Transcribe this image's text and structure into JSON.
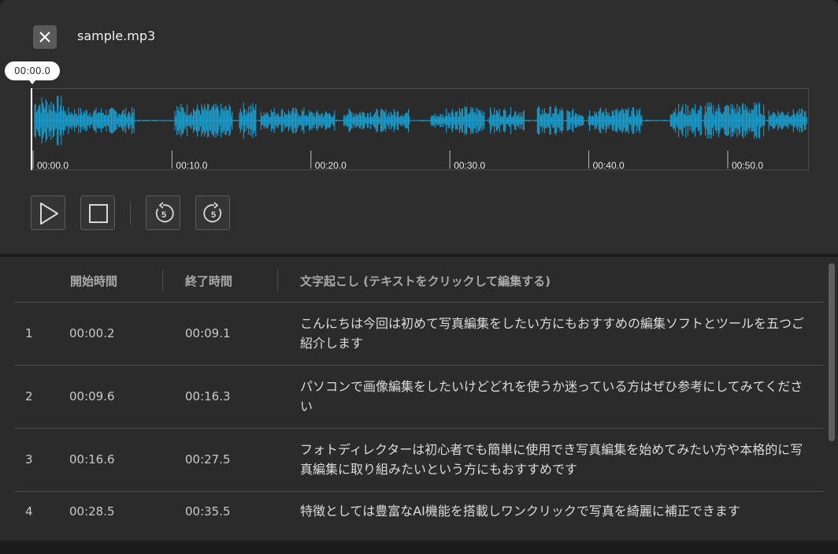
{
  "header": {
    "close_icon": "close-icon",
    "file_name": "sample.mp3"
  },
  "player": {
    "current_time": "00:00.0",
    "timeline_ticks": [
      "00:00.0",
      "00:10.0",
      "00:20.0",
      "00:30.0",
      "00:40.0",
      "00:50.0"
    ],
    "waveform_color": "#1a9fd0",
    "controls": [
      {
        "name": "play-button",
        "icon": "play-icon"
      },
      {
        "name": "stop-button",
        "icon": "stop-icon"
      },
      {
        "name": "rewind-5-button",
        "icon": "rewind-5-icon",
        "label": "5"
      },
      {
        "name": "forward-5-button",
        "icon": "forward-5-icon",
        "label": "5"
      }
    ]
  },
  "table": {
    "columns": [
      "開始時間",
      "終了時間",
      "文字起こし (テキストをクリックして編集する)"
    ],
    "rows": [
      {
        "index": "1",
        "start": "00:00.2",
        "end": "00:09.1",
        "text": "こんにちは今回は初めて写真編集をしたい方にもおすすめの編集ソフトとツールを五つご紹介します"
      },
      {
        "index": "2",
        "start": "00:09.6",
        "end": "00:16.3",
        "text": "パソコンで画像編集をしたいけどどれを使うか迷っている方はぜひ参考にしてみてください"
      },
      {
        "index": "3",
        "start": "00:16.6",
        "end": "00:27.5",
        "text": "フォトディレクターは初心者でも簡単に使用でき写真編集を始めてみたい方や本格的に写真編集に取り組みたいという方にもおすすめです"
      },
      {
        "index": "4",
        "start": "00:28.5",
        "end": "00:35.5",
        "text": "特徴としては豊富なAI機能を搭載しワンクリックで写真を綺麗に補正できます"
      }
    ]
  }
}
